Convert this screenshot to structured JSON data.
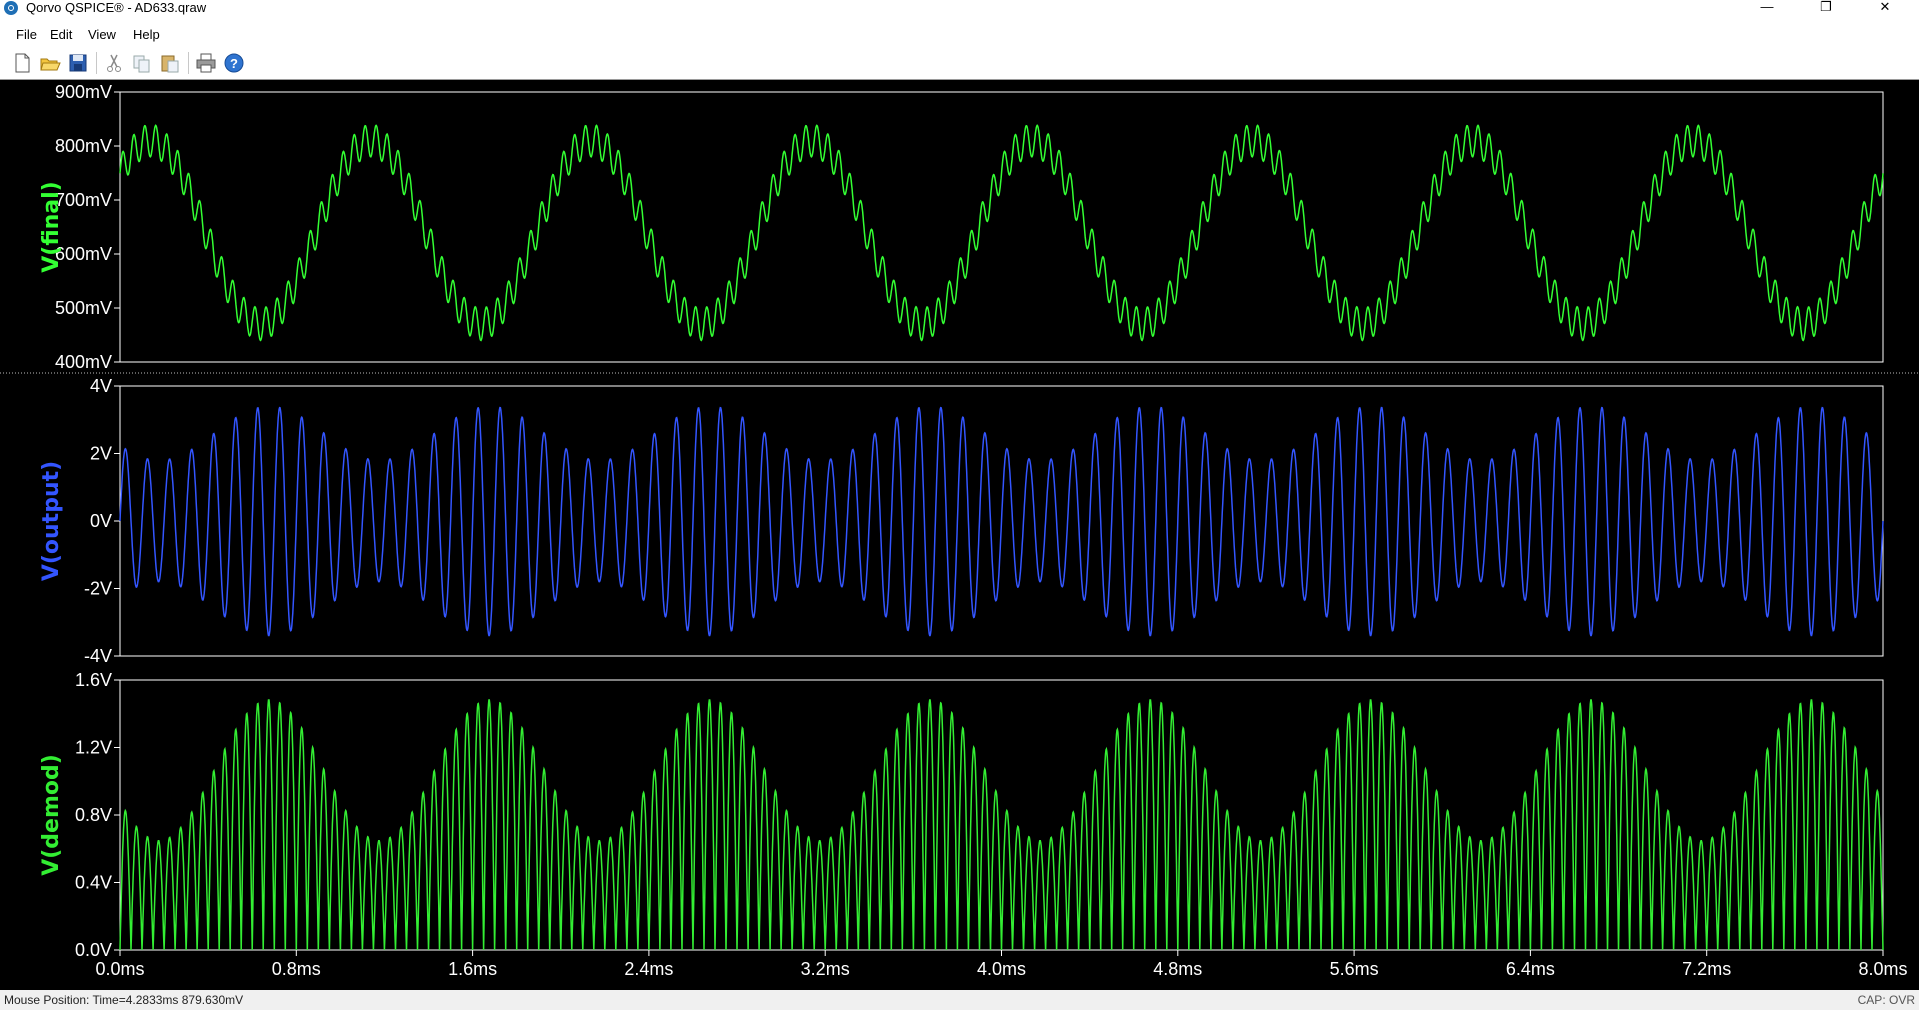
{
  "window": {
    "title": "Qorvo QSPICE® - AD633.qraw",
    "controls": {
      "minimize": "—",
      "maximize": "❐",
      "close": "✕"
    }
  },
  "menu": {
    "items": [
      "File",
      "Edit",
      "View",
      "Help"
    ]
  },
  "toolbar": {
    "buttons": [
      "new-icon",
      "open-icon",
      "save-icon",
      "cut-icon",
      "copy-icon",
      "paste-icon",
      "print-icon",
      "help-icon"
    ]
  },
  "status": {
    "mouse_position": "Mouse Position: Time=4.2833ms  879.630mV",
    "caps": "CAP: OVR"
  },
  "colors": {
    "final": "#33ff33",
    "output": "#3355ff",
    "demod": "#33ee33",
    "background": "#000000",
    "frame": "#ffffff"
  },
  "chart_data": [
    {
      "type": "line",
      "ylabel": "V(final)",
      "yticks": [
        "900mV",
        "800mV",
        "700mV",
        "600mV",
        "500mV",
        "400mV"
      ],
      "ylim": [
        0.4,
        0.9
      ],
      "xlim": [
        0,
        8.0
      ],
      "series": [
        {
          "name": "V(final)",
          "description_values": {
            "envelope_freq_khz": 1.0,
            "center_v": 0.64,
            "envelope_amp_v": 0.17,
            "ripple_freq_khz": 20,
            "ripple_amp_v": 0.03
          }
        }
      ]
    },
    {
      "type": "line",
      "ylabel": "V(output)",
      "yticks": [
        "4V",
        "2V",
        "0V",
        "-2V",
        "-4V"
      ],
      "ylim": [
        -4,
        4
      ],
      "xlim": [
        0,
        8.0
      ],
      "series": [
        {
          "name": "V(output)",
          "description_values": {
            "carrier_freq_khz": 10,
            "mean_amp_v": 2.6,
            "mod_amp_v": 0.8,
            "mod_freq_khz": 1.0
          }
        }
      ]
    },
    {
      "type": "line",
      "ylabel": "V(demod)",
      "yticks": [
        "1.6V",
        "1.2V",
        "0.8V",
        "0.4V",
        "0.0V"
      ],
      "ylim": [
        0,
        1.8
      ],
      "xlim": [
        0,
        8.0
      ],
      "xticks": [
        "0.0ms",
        "0.8ms",
        "1.6ms",
        "2.4ms",
        "3.2ms",
        "4.0ms",
        "4.8ms",
        "5.6ms",
        "6.4ms",
        "7.2ms",
        "8.0ms"
      ],
      "series": [
        {
          "name": "V(demod)",
          "description_values": {
            "rect_freq_khz": 20,
            "mean_amp_v": 1.2,
            "mod_amp_v": 0.47,
            "mod_freq_khz": 1.0
          }
        }
      ]
    }
  ]
}
